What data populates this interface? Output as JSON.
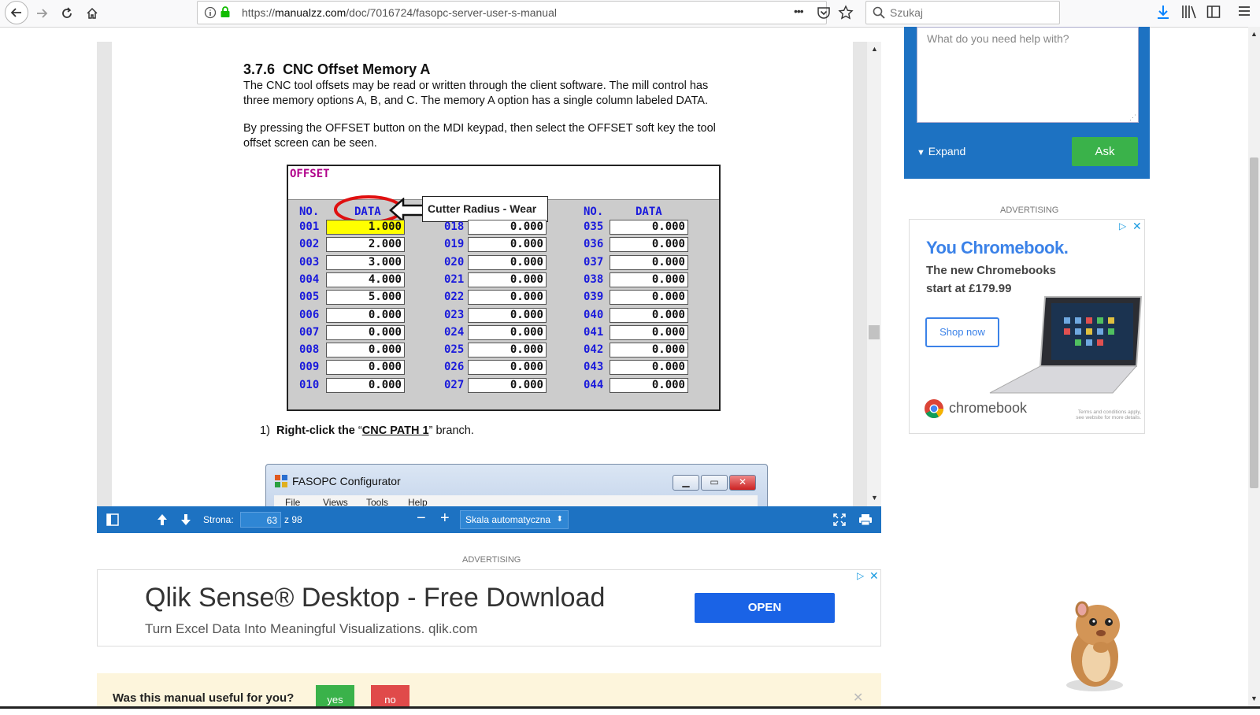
{
  "browser": {
    "url": "https://manualzz.com/doc/7016724/fasopc-server-user-s-manual",
    "url_prefix": "https://",
    "url_domain": "manualzz.com",
    "url_path": "/doc/7016724/fasopc-server-user-s-manual",
    "search_placeholder": "Szukaj",
    "menu_dots": "•••"
  },
  "document": {
    "heading_num": "3.7.6",
    "heading_title": "CNC Offset Memory A",
    "para1_line1": "The CNC tool offsets may be read or written through the client software. The mill control has",
    "para1_line2": "three memory options A, B, and C. The memory A option has a single column labeled DATA.",
    "para2_line1": "By pressing the OFFSET button on the MDI keypad, then select the OFFSET soft key the tool",
    "para2_line2": "offset screen can be seen.",
    "step_num": "1)",
    "step_bold": "Right-click the",
    "step_quote_open": "“",
    "step_link": "CNC PATH 1",
    "step_quote_close": "”",
    "step_rest": "branch.",
    "configurator_title": "FASOPC Configurator",
    "configurator_menu": [
      "File",
      "Views",
      "Tools",
      "Help"
    ]
  },
  "offset_screen": {
    "title": "OFFSET",
    "col_no": "NO.",
    "col_data": "DATA",
    "callout": "Cutter Radius - Wear",
    "columns": [
      {
        "nos": [
          "001",
          "002",
          "003",
          "004",
          "005",
          "006",
          "007",
          "008",
          "009",
          "010"
        ],
        "vals": [
          "1.000",
          "2.000",
          "3.000",
          "4.000",
          "5.000",
          "0.000",
          "0.000",
          "0.000",
          "0.000",
          "0.000"
        ]
      },
      {
        "nos": [
          "018",
          "019",
          "020",
          "021",
          "022",
          "023",
          "024",
          "025",
          "026",
          "027"
        ],
        "vals": [
          "0.000",
          "0.000",
          "0.000",
          "0.000",
          "0.000",
          "0.000",
          "0.000",
          "0.000",
          "0.000",
          "0.000"
        ]
      },
      {
        "nos": [
          "035",
          "036",
          "037",
          "038",
          "039",
          "040",
          "041",
          "042",
          "043",
          "044"
        ],
        "vals": [
          "0.000",
          "0.000",
          "0.000",
          "0.000",
          "0.000",
          "0.000",
          "0.000",
          "0.000",
          "0.000",
          "0.000"
        ]
      }
    ]
  },
  "pdf_toolbar": {
    "page_label": "Strona:",
    "page_value": "63",
    "page_total": "z 98",
    "zoom_value": "Skala automatyczna"
  },
  "help_box": {
    "placeholder": "What do you need help with?",
    "expand_label": "Expand",
    "ask_label": "Ask"
  },
  "side_ad": {
    "label": "ADVERTISING",
    "headline": "You Chromebook.",
    "subline1": "The new Chromebooks",
    "subline2": "start at £179.99",
    "cta": "Shop now",
    "brand": "chromebook",
    "terms1": "Terms and conditions apply,",
    "terms2": "see website for more details."
  },
  "bottom_ad": {
    "label": "ADVERTISING",
    "headline": "Qlik Sense® Desktop - Free Download",
    "subline": "Turn Excel Data Into Meaningful Visualizations. qlik.com",
    "cta": "OPEN"
  },
  "feedback": {
    "question": "Was this manual useful for you?",
    "yes": "yes",
    "no": "no"
  },
  "colors": {
    "accent_blue": "#1d72c2",
    "ask_green": "#3ab24a",
    "open_blue": "#1a63e6",
    "highlight_yellow": "#ffff00"
  }
}
